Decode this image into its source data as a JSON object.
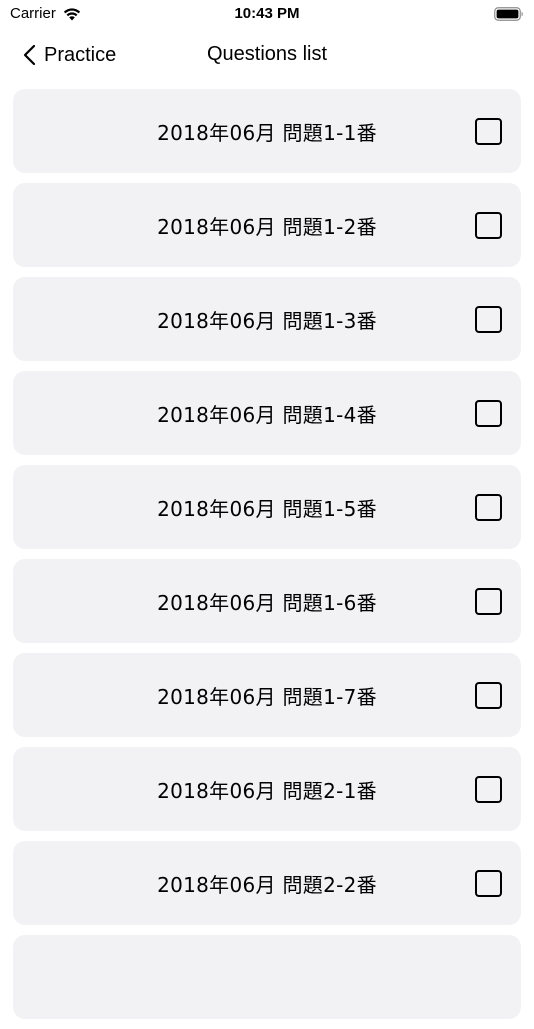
{
  "status": {
    "carrier": "Carrier",
    "time": "10:43 PM"
  },
  "nav": {
    "back_label": "Practice",
    "title": "Questions list"
  },
  "items": [
    {
      "label": "2018年06月 問題1-1番",
      "checked": false
    },
    {
      "label": "2018年06月 問題1-2番",
      "checked": false
    },
    {
      "label": "2018年06月 問題1-3番",
      "checked": false
    },
    {
      "label": "2018年06月 問題1-4番",
      "checked": false
    },
    {
      "label": "2018年06月 問題1-5番",
      "checked": false
    },
    {
      "label": "2018年06月 問題1-6番",
      "checked": false
    },
    {
      "label": "2018年06月 問題1-7番",
      "checked": false
    },
    {
      "label": "2018年06月 問題2-1番",
      "checked": false
    },
    {
      "label": "2018年06月 問題2-2番",
      "checked": false
    }
  ]
}
